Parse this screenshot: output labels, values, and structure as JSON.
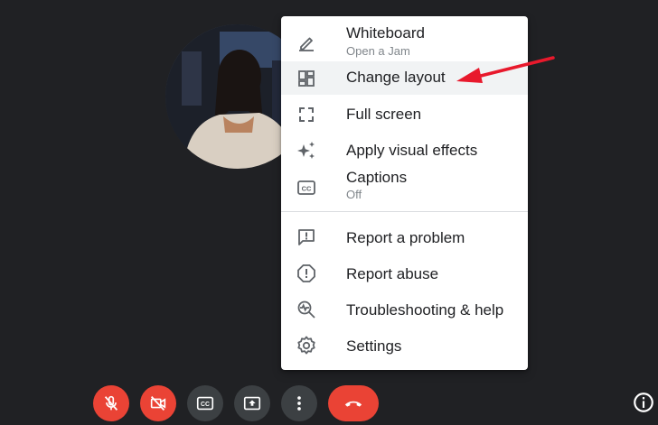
{
  "menu": {
    "items": [
      {
        "label": "Whiteboard",
        "sublabel": "Open a Jam",
        "icon": "pencil-icon"
      },
      {
        "label": "Change layout",
        "icon": "layout-icon"
      },
      {
        "label": "Full screen",
        "icon": "fullscreen-icon"
      },
      {
        "label": "Apply visual effects",
        "icon": "sparkle-icon"
      },
      {
        "label": "Captions",
        "sublabel": "Off",
        "icon": "captions-icon"
      },
      {
        "label": "Report a problem",
        "icon": "feedback-icon"
      },
      {
        "label": "Report abuse",
        "icon": "report-icon"
      },
      {
        "label": "Troubleshooting & help",
        "icon": "troubleshoot-icon"
      },
      {
        "label": "Settings",
        "icon": "gear-icon"
      }
    ]
  },
  "toolbar": {
    "buttons": [
      {
        "name": "mic-off-button",
        "icon": "mic-off-icon",
        "color": "#ea4335"
      },
      {
        "name": "camera-off-button",
        "icon": "camera-off-icon",
        "color": "#ea4335"
      },
      {
        "name": "captions-button",
        "icon": "captions-icon",
        "color": "#3c4043"
      },
      {
        "name": "present-button",
        "icon": "present-icon",
        "color": "#3c4043"
      },
      {
        "name": "more-options-button",
        "icon": "more-vert-icon",
        "color": "#3c4043"
      },
      {
        "name": "leave-call-button",
        "icon": "hang-up-icon",
        "color": "#ea4335"
      }
    ]
  },
  "colors": {
    "background": "#202124",
    "accent_red": "#ea4335",
    "button_grey": "#3c4043",
    "annotation_arrow": "#e8192c"
  }
}
